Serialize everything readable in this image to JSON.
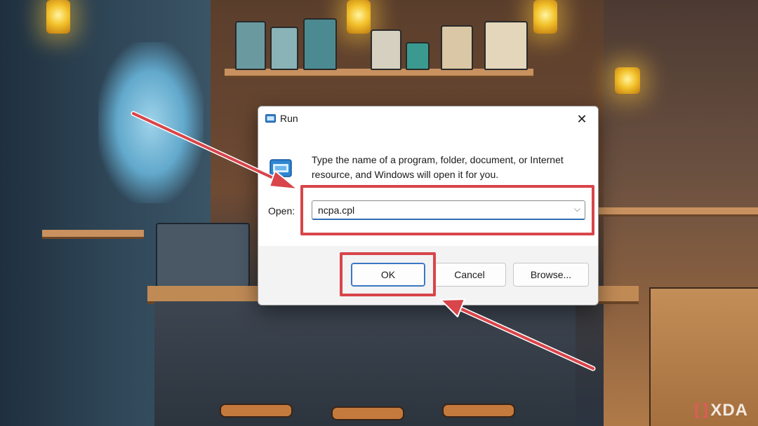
{
  "dialog": {
    "title": "Run",
    "close_glyph": "✕",
    "description": "Type the name of a program, folder, document, or Internet resource, and Windows will open it for you.",
    "open_label": "Open:",
    "command_value": "ncpa.cpl",
    "dropdown_glyph": "⌵",
    "buttons": {
      "ok": "OK",
      "cancel": "Cancel",
      "browse": "Browse..."
    },
    "icons": {
      "title": "run-icon",
      "body": "run-icon",
      "close": "close-icon",
      "dropdown": "chevron-down-icon"
    }
  },
  "annotation": {
    "highlight_color": "#d8454a",
    "targets": [
      "command-input",
      "ok-button"
    ]
  },
  "watermark": {
    "text": "XDA",
    "icon": "xda-logo-icon"
  },
  "colors": {
    "accent": "#3a78c4",
    "dialog_bg": "#f3f3f3",
    "highlight": "#d8454a"
  }
}
